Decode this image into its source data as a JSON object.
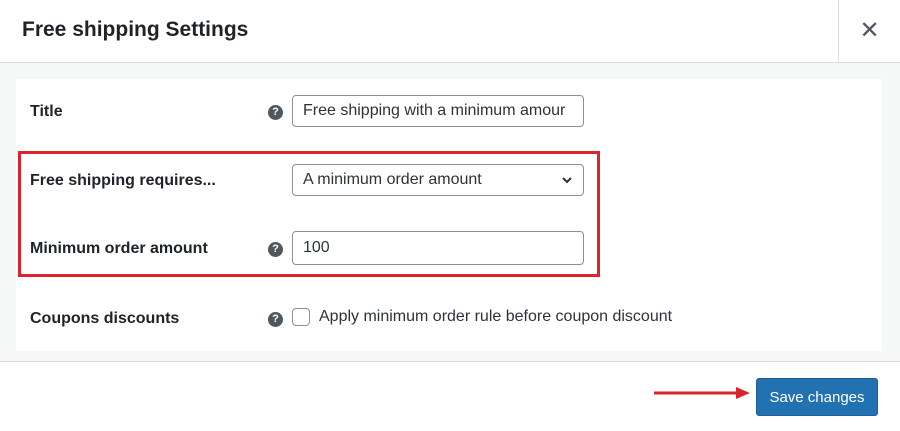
{
  "modal": {
    "title": "Free shipping Settings",
    "close_icon": "close-icon"
  },
  "fields": {
    "title": {
      "label": "Title",
      "value": "Free shipping with a minimum amour"
    },
    "requires": {
      "label": "Free shipping requires...",
      "selected": "A minimum order amount"
    },
    "min_amount": {
      "label": "Minimum order amount",
      "value": "100"
    },
    "coupons": {
      "label": "Coupons discounts",
      "checkbox_label": "Apply minimum order rule before coupon discount",
      "checked": false
    }
  },
  "footer": {
    "save_label": "Save changes"
  },
  "colors": {
    "primary": "#2271b1",
    "highlight": "#d9252b",
    "arrow": "#d9252b"
  }
}
